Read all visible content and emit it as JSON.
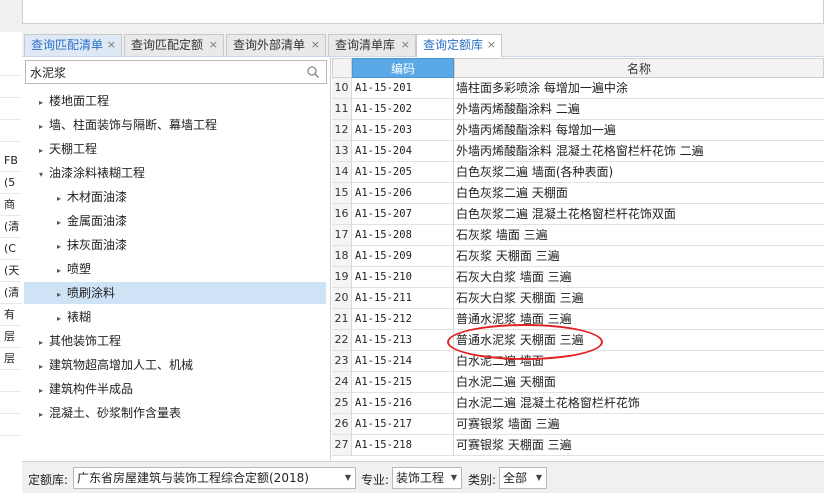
{
  "left_strip": [
    "FB",
    "(5",
    "商",
    "(清",
    "(C",
    "(天",
    "(清",
    "有",
    "层",
    "层"
  ],
  "tabs": [
    {
      "label": "查询匹配清单",
      "close": "×"
    },
    {
      "label": "查询匹配定额",
      "close": "×"
    },
    {
      "label": "查询外部清单",
      "close": "×"
    },
    {
      "label": "查询清单库",
      "close": "×"
    },
    {
      "label": "查询定额库",
      "close": "×"
    }
  ],
  "search": {
    "value": "水泥浆"
  },
  "tree": [
    {
      "label": "楼地面工程",
      "arrow": "▸"
    },
    {
      "label": "墙、柱面装饰与隔断、幕墙工程",
      "arrow": "▸"
    },
    {
      "label": "天棚工程",
      "arrow": "▸"
    },
    {
      "label": "油漆涂料裱糊工程",
      "arrow": "▾"
    },
    {
      "label": "木材面油漆",
      "arrow": "▸"
    },
    {
      "label": "金属面油漆",
      "arrow": "▸"
    },
    {
      "label": "抹灰面油漆",
      "arrow": "▸"
    },
    {
      "label": "喷塑",
      "arrow": "▸"
    },
    {
      "label": "喷刷涂料",
      "arrow": "▸"
    },
    {
      "label": "裱糊",
      "arrow": "▸"
    },
    {
      "label": "其他装饰工程",
      "arrow": "▸"
    },
    {
      "label": "建筑物超高增加人工、机械",
      "arrow": "▸"
    },
    {
      "label": "建筑构件半成品",
      "arrow": "▸"
    },
    {
      "label": "混凝土、砂浆制作含量表",
      "arrow": "▸"
    }
  ],
  "grid": {
    "col_code": "编码",
    "col_name": "名称",
    "rows": [
      {
        "n": "10",
        "code": "A1-15-201",
        "name": "墙柱面多彩喷涂 每增加一遍中涂"
      },
      {
        "n": "11",
        "code": "A1-15-202",
        "name": "外墙丙烯酸酯涂料 二遍"
      },
      {
        "n": "12",
        "code": "A1-15-203",
        "name": "外墙丙烯酸酯涂料 每增加一遍"
      },
      {
        "n": "13",
        "code": "A1-15-204",
        "name": "外墙丙烯酸酯涂料 混凝土花格窗栏杆花饰 二遍"
      },
      {
        "n": "14",
        "code": "A1-15-205",
        "name": "白色灰浆二遍 墙面(各种表面)"
      },
      {
        "n": "15",
        "code": "A1-15-206",
        "name": "白色灰浆二遍 天棚面"
      },
      {
        "n": "16",
        "code": "A1-15-207",
        "name": "白色灰浆二遍 混凝土花格窗栏杆花饰双面"
      },
      {
        "n": "17",
        "code": "A1-15-208",
        "name": "石灰浆 墙面 三遍"
      },
      {
        "n": "18",
        "code": "A1-15-209",
        "name": "石灰浆 天棚面 三遍"
      },
      {
        "n": "19",
        "code": "A1-15-210",
        "name": "石灰大白浆 墙面 三遍"
      },
      {
        "n": "20",
        "code": "A1-15-211",
        "name": "石灰大白浆 天棚面 三遍"
      },
      {
        "n": "21",
        "code": "A1-15-212",
        "name": "普通水泥浆 墙面 三遍"
      },
      {
        "n": "22",
        "code": "A1-15-213",
        "name": "普通水泥浆 天棚面 三遍"
      },
      {
        "n": "23",
        "code": "A1-15-214",
        "name": "白水泥二遍 墙面"
      },
      {
        "n": "24",
        "code": "A1-15-215",
        "name": "白水泥二遍 天棚面"
      },
      {
        "n": "25",
        "code": "A1-15-216",
        "name": "白水泥二遍 混凝土花格窗栏杆花饰"
      },
      {
        "n": "26",
        "code": "A1-15-217",
        "name": "可赛银浆 墙面 三遍"
      },
      {
        "n": "27",
        "code": "A1-15-218",
        "name": "可赛银浆 天棚面 三遍"
      }
    ]
  },
  "bottom": {
    "quota_label": "定额库:",
    "quota_value": "广东省房屋建筑与装饰工程综合定额(2018)",
    "major_label": "专业:",
    "major_value": "装饰工程",
    "category_label": "类别:",
    "category_value": "全部"
  },
  "colors": {
    "accent": "#2b71c7",
    "header_blue": "#5aa8e6",
    "highlight": "#e02020",
    "selected_row": "#cfe3f7"
  }
}
